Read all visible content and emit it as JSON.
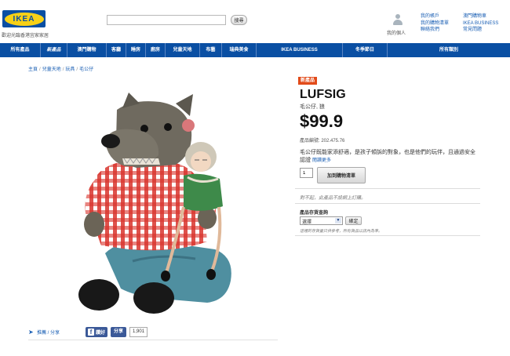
{
  "header": {
    "logo_text": "IKEA",
    "tagline": "歡迎光臨香港宜家家居",
    "search_button": "搜尋",
    "profile_label": "我的個人",
    "links_left": [
      "我的帳戶",
      "我的購物清單",
      "聯絡我們"
    ],
    "links_right": [
      "澳門購物車",
      "IKEA BUSINESS",
      "常見問題"
    ]
  },
  "nav": {
    "items": [
      {
        "label": "所有產品",
        "width": 52
      },
      {
        "label": "新產品",
        "width": 34,
        "active": true
      },
      {
        "label": "澳門購物",
        "width": 50
      },
      {
        "label": "客廳",
        "width": 25
      },
      {
        "label": "睡房",
        "width": 25
      },
      {
        "label": "廚房",
        "width": 25
      },
      {
        "label": "兒童天地",
        "width": 44
      },
      {
        "label": "布藝",
        "width": 28
      },
      {
        "label": "瑞典美食",
        "width": 44
      },
      {
        "label": "IKEA BUSINESS",
        "width": 110
      },
      {
        "label": "冬季節日",
        "width": 57
      },
      {
        "label": "所有類別",
        "width": 156
      }
    ]
  },
  "breadcrumb": [
    "主頁",
    "兒童天地",
    "玩具",
    "毛公仔"
  ],
  "product": {
    "badge": "新產品",
    "name": "LUFSIG",
    "description": "毛公仔, 狼",
    "price": "$99.9",
    "article": "產品編號: 202.475.76",
    "long_description": "毛公仔既能家添舒適，是孩子傾訴的對象，也是他們的玩伴，且通過安全認證",
    "read_more": "閱讀更多",
    "quantity": "1",
    "add_to_cart": "加到購物清單",
    "note": "對不起，此產品不設網上訂購。",
    "stock_title": "產品存貨查詢",
    "store_selected": "選擇",
    "check_button": "確定",
    "stock_note": "這裡的存貨量只供參考，所有貨品以店內為準。"
  },
  "share": {
    "share_text": "推薦 / 分享",
    "fb_label": "讚好",
    "share_label": "分享",
    "count": "1,901"
  },
  "colors": {
    "nav_blue": "#0a4fa3",
    "logo_yellow": "#f7d117",
    "badge_red": "#e24b1a",
    "link_blue": "#1a5fb4",
    "facebook": "#3b5998"
  }
}
